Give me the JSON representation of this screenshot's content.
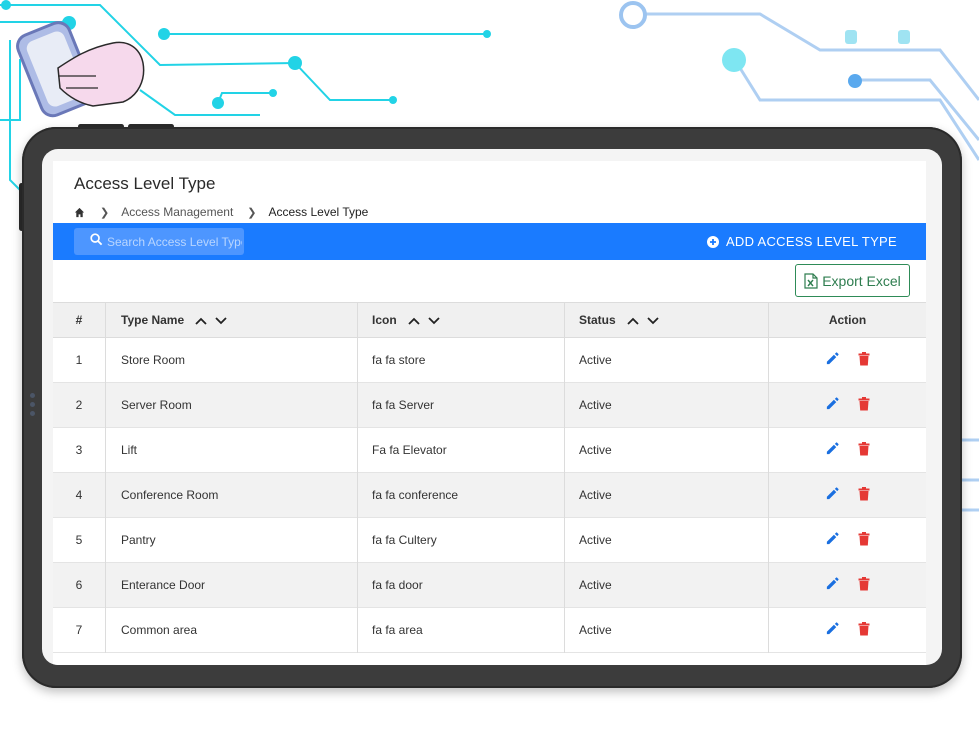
{
  "page": {
    "title": "Access Level Type",
    "breadcrumb": [
      "Access Management",
      "Access Level Type"
    ]
  },
  "toolbar": {
    "search_placeholder": "Search Access Level Type",
    "add_label": "ADD ACCESS LEVEL TYPE",
    "export_label": "Export Excel"
  },
  "table": {
    "headers": {
      "num": "#",
      "name": "Type Name",
      "icon": "Icon",
      "status": "Status",
      "action": "Action"
    },
    "rows": [
      {
        "num": "1",
        "name": "Store Room",
        "icon": "fa fa store",
        "status": "Active"
      },
      {
        "num": "2",
        "name": "Server Room",
        "icon": "fa fa Server",
        "status": "Active"
      },
      {
        "num": "3",
        "name": "Lift",
        "icon": "Fa fa Elevator",
        "status": "Active"
      },
      {
        "num": "4",
        "name": "Conference Room",
        "icon": "fa fa conference",
        "status": "Active"
      },
      {
        "num": "5",
        "name": "Pantry",
        "icon": "fa fa Cultery",
        "status": "Active"
      },
      {
        "num": "6",
        "name": "Enterance Door",
        "icon": "fa fa door",
        "status": "Active"
      },
      {
        "num": "7",
        "name": "Common area",
        "icon": "fa fa area",
        "status": "Active"
      }
    ]
  },
  "colors": {
    "accent": "#1a7bff",
    "edit": "#1a6fe0",
    "delete": "#e53935",
    "export": "#2e8b57",
    "circuit": "#22d3e6"
  },
  "icons": [
    "home-icon",
    "chevron-right-icon",
    "search-icon",
    "add-circle-icon",
    "excel-icon",
    "sort-up-icon",
    "sort-down-icon",
    "edit-icon",
    "delete-icon"
  ]
}
